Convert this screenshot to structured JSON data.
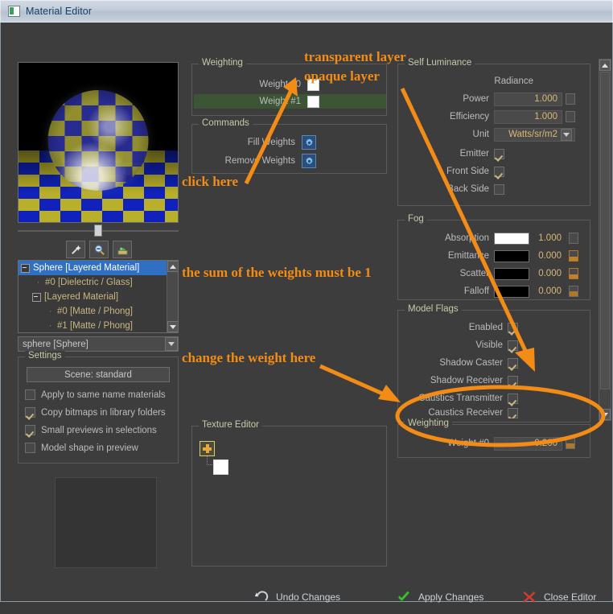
{
  "window": {
    "title": "Material Editor",
    "icon": "window-icon"
  },
  "preview": {
    "toolbar": [
      {
        "name": "magic-wand-icon",
        "label": "wand"
      },
      {
        "name": "zoom-out-icon",
        "label": "zoom"
      },
      {
        "name": "save-preview-icon",
        "label": "save"
      }
    ]
  },
  "tree": {
    "nodes": [
      {
        "label": "Sphere [Layered Material]",
        "depth": 0,
        "expander": "minus",
        "selected": true
      },
      {
        "label": "#0 [Dielectric / Glass]",
        "depth": 1,
        "expander": "none",
        "selected": false
      },
      {
        "label": "[Layered Material]",
        "depth": 1,
        "expander": "minus",
        "selected": false
      },
      {
        "label": "#0 [Matte / Phong]",
        "depth": 2,
        "expander": "none",
        "selected": false
      },
      {
        "label": "#1 [Matte / Phong]",
        "depth": 2,
        "expander": "none",
        "selected": false
      }
    ]
  },
  "object_selector": {
    "value": "sphere [Sphere]"
  },
  "settings": {
    "legend": "Settings",
    "scene_button": "Scene: standard",
    "checkboxes": [
      {
        "label": "Apply to same name materials",
        "checked": false
      },
      {
        "label": "Copy bitmaps in library folders",
        "checked": true
      },
      {
        "label": "Small previews in selections",
        "checked": true
      },
      {
        "label": "Model shape in preview",
        "checked": false
      }
    ]
  },
  "weighting_top": {
    "legend": "Weighting",
    "rows": [
      {
        "label": "Weight #0",
        "checked": false,
        "highlighted": false
      },
      {
        "label": "Weight #1",
        "checked": false,
        "highlighted": true
      }
    ]
  },
  "commands": {
    "legend": "Commands",
    "items": [
      {
        "label": "Fill Weights",
        "icon": "gear-icon"
      },
      {
        "label": "Remove Weights",
        "icon": "gear-icon"
      }
    ]
  },
  "texture_editor": {
    "legend": "Texture Editor",
    "add_icon": "plus-icon",
    "swatch_color": "#ffffff"
  },
  "self_luminance": {
    "legend": "Self Luminance",
    "radiance_label": "Radiance",
    "fields": [
      {
        "label": "Power",
        "value": "1.000",
        "spinner": "plain"
      },
      {
        "label": "Efficiency",
        "value": "1.000",
        "spinner": "plain"
      }
    ],
    "unit": {
      "label": "Unit",
      "value": "Watts/sr/m2"
    },
    "checkboxes": [
      {
        "label": "Emitter",
        "checked": true
      },
      {
        "label": "Front Side",
        "checked": true
      },
      {
        "label": "Back Side",
        "checked": false
      }
    ]
  },
  "fog": {
    "legend": "Fog",
    "rows": [
      {
        "label": "Absorption",
        "color": "#ffffff",
        "value": "1.000",
        "spinner": "plain"
      },
      {
        "label": "Emittance",
        "color": "#000000",
        "value": "0.000",
        "spinner": "orange"
      },
      {
        "label": "Scatter",
        "color": "#000000",
        "value": "0.000",
        "spinner": "orange"
      },
      {
        "label": "Falloff",
        "color": "#000000",
        "value": "0.000",
        "spinner": "half"
      }
    ]
  },
  "model_flags": {
    "legend": "Model Flags",
    "checkboxes": [
      {
        "label": "Enabled",
        "checked": true
      },
      {
        "label": "Visible",
        "checked": true
      },
      {
        "label": "Shadow Caster",
        "checked": true
      },
      {
        "label": "Shadow Receiver",
        "checked": true
      },
      {
        "label": "Caustics Transmitter",
        "checked": true
      },
      {
        "label": "Caustics Receiver",
        "checked": true
      }
    ]
  },
  "weighting_bottom": {
    "legend": "Weighting",
    "label": "Weight #0",
    "value": "0.200",
    "spinner": "half"
  },
  "bottom_bar": {
    "undo": {
      "label": "Undo Changes",
      "icon": "undo-icon"
    },
    "apply": {
      "label": "Apply Changes",
      "icon": "check-icon"
    },
    "close": {
      "label": "Close Editor",
      "icon": "close-x-icon"
    }
  },
  "annotations": {
    "transparent_layer": "transparent layer",
    "opaque_layer": "opaque layer",
    "click_here": "click here",
    "sum_note": "the sum of the weights must be 1",
    "change_weight": "change the weight here"
  },
  "colors": {
    "annotation": "#f28c16",
    "panel_bg": "#3d3d3d",
    "legend": "#c8c9a8",
    "value": "#d9b874",
    "selection": "#2f6fc4"
  }
}
